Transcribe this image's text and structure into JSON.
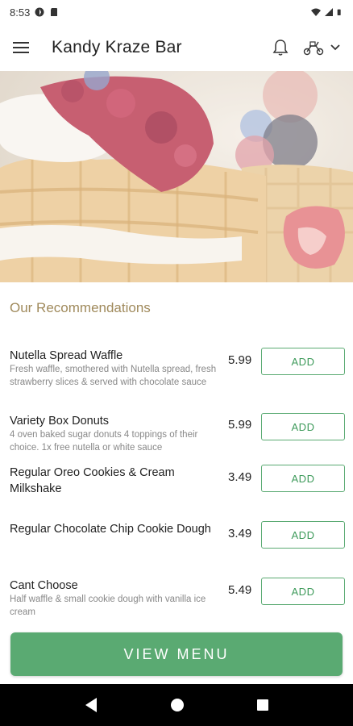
{
  "status_bar": {
    "time": "8:53"
  },
  "app_bar": {
    "title": "Kandy Kraze Bar"
  },
  "section": {
    "title": "Our Recommendations"
  },
  "items": [
    {
      "name": "Nutella Spread Waffle",
      "description": "Fresh waffle, smothered with Nutella spread, fresh strawberry slices & served with chocolate sauce",
      "price": "5.99",
      "add_label": "ADD"
    },
    {
      "name": "Variety Box Donuts",
      "description": "4 oven baked sugar donuts 4 toppings of their choice. 1x free nutella or white sauce",
      "price": "5.99",
      "add_label": "ADD"
    },
    {
      "name": "Regular Oreo Cookies & Cream Milkshake",
      "description": "",
      "price": "3.49",
      "add_label": "ADD"
    },
    {
      "name": "Regular Chocolate Chip Cookie Dough",
      "description": "",
      "price": "3.49",
      "add_label": "ADD"
    },
    {
      "name": "Cant Choose",
      "description": "Half waffle & small cookie dough with vanilla ice cream",
      "price": "5.49",
      "add_label": "ADD"
    }
  ],
  "view_menu": {
    "label": "VIEW MENU"
  },
  "colors": {
    "accent_green": "#5aaa72",
    "section_title": "#a08a5c"
  }
}
